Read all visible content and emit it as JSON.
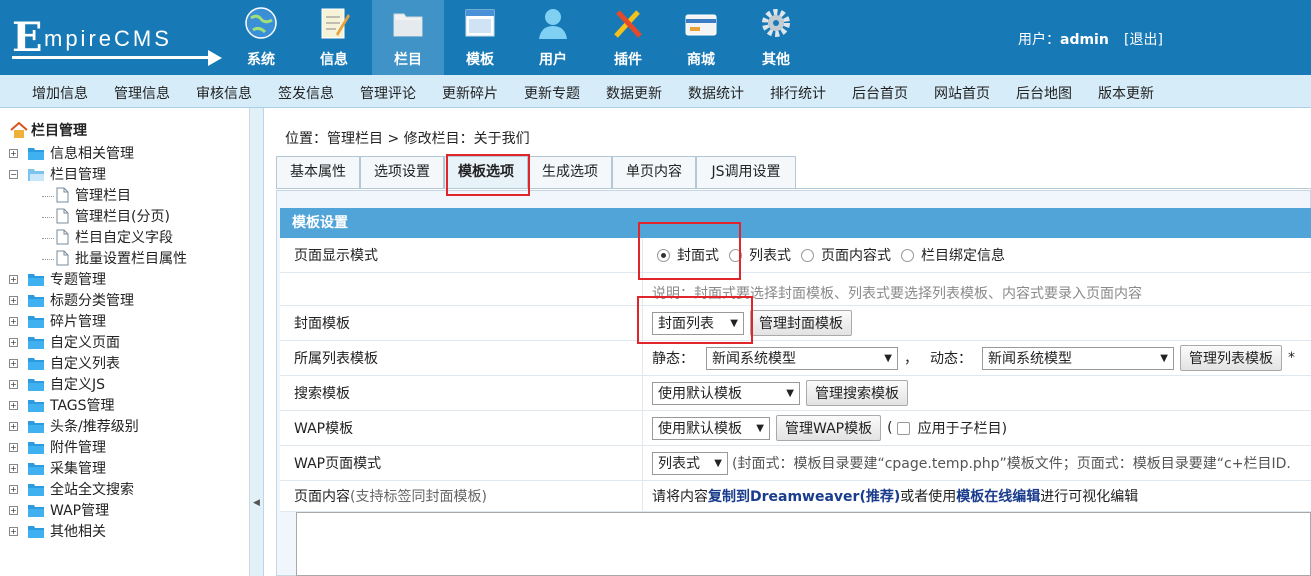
{
  "brand": {
    "letter": "E",
    "text": "mpireCMS"
  },
  "nav": [
    {
      "label": "系统",
      "icon": "globe-icon"
    },
    {
      "label": "信息",
      "icon": "notepad-icon"
    },
    {
      "label": "栏目",
      "icon": "folder-icon",
      "active": true
    },
    {
      "label": "模板",
      "icon": "window-icon"
    },
    {
      "label": "用户",
      "icon": "user-icon"
    },
    {
      "label": "插件",
      "icon": "tools-icon"
    },
    {
      "label": "商城",
      "icon": "card-icon"
    },
    {
      "label": "其他",
      "icon": "gear-icon"
    }
  ],
  "user": {
    "prefix": "用户：",
    "name": "admin",
    "logout": "[退出]"
  },
  "menu": [
    "增加信息",
    "管理信息",
    "审核信息",
    "签发信息",
    "管理评论",
    "更新碎片",
    "更新专题",
    "数据更新",
    "数据统计",
    "排行统计",
    "后台首页",
    "网站首页",
    "后台地图",
    "版本更新"
  ],
  "sidebar": {
    "root": "栏目管理",
    "items": [
      {
        "label": "信息相关管理",
        "type": "folder"
      },
      {
        "label": "栏目管理",
        "type": "folder-open"
      },
      {
        "label": "管理栏目",
        "type": "page"
      },
      {
        "label": "管理栏目(分页)",
        "type": "page"
      },
      {
        "label": "栏目自定义字段",
        "type": "page"
      },
      {
        "label": "批量设置栏目属性",
        "type": "page"
      },
      {
        "label": "专题管理",
        "type": "folder"
      },
      {
        "label": "标题分类管理",
        "type": "folder"
      },
      {
        "label": "碎片管理",
        "type": "folder"
      },
      {
        "label": "自定义页面",
        "type": "folder"
      },
      {
        "label": "自定义列表",
        "type": "folder"
      },
      {
        "label": "自定义JS",
        "type": "folder"
      },
      {
        "label": "TAGS管理",
        "type": "folder"
      },
      {
        "label": "头条/推荐级别",
        "type": "folder"
      },
      {
        "label": "附件管理",
        "type": "folder"
      },
      {
        "label": "采集管理",
        "type": "folder"
      },
      {
        "label": "全站全文搜索",
        "type": "folder"
      },
      {
        "label": "WAP管理",
        "type": "folder"
      },
      {
        "label": "其他相关",
        "type": "folder"
      }
    ]
  },
  "breadcrumb": "位置：管理栏目 > 修改栏目：关于我们",
  "tabs": [
    "基本属性",
    "选项设置",
    "模板选项",
    "生成选项",
    "单页内容",
    "JS调用设置"
  ],
  "active_tab": 2,
  "form": {
    "header": "模板设置",
    "display_mode": {
      "label": "页面显示模式",
      "options": [
        "封面式",
        "列表式",
        "页面内容式",
        "栏目绑定信息"
      ],
      "selected": 0
    },
    "note": "说明：封面式要选择封面模板、列表式要选择列表模板、内容式要录入页面内容",
    "cover": {
      "label": "封面模板",
      "value": "封面列表",
      "button": "管理封面模板"
    },
    "list": {
      "label": "所属列表模板",
      "static_label": "静态：",
      "static_value": "新闻系统模型",
      "sep": "，",
      "dynamic_label": "动态：",
      "dynamic_value": "新闻系统模型",
      "button": "管理列表模板",
      "star": "*"
    },
    "search": {
      "label": "搜索模板",
      "value": "使用默认模板",
      "button": "管理搜索模板"
    },
    "wap": {
      "label": "WAP模板",
      "value": "使用默认模板",
      "button": "管理WAP模板",
      "paren_open": "(",
      "check_label": "应用于子栏目)"
    },
    "wap_mode": {
      "label": "WAP页面模式",
      "value": "列表式",
      "note": "(封面式：模板目录要建“cpage.temp.php”模板文件；页面式：模板目录要建“c+栏目ID."
    },
    "content": {
      "label": "页面内容",
      "label_note": "(支持标签同封面模板)",
      "t1": "请将内容",
      "l1": "复制到Dreamweaver(推荐)",
      "t2": "或者使用",
      "l2": "模板在线编辑",
      "t3": "进行可视化编辑"
    }
  }
}
